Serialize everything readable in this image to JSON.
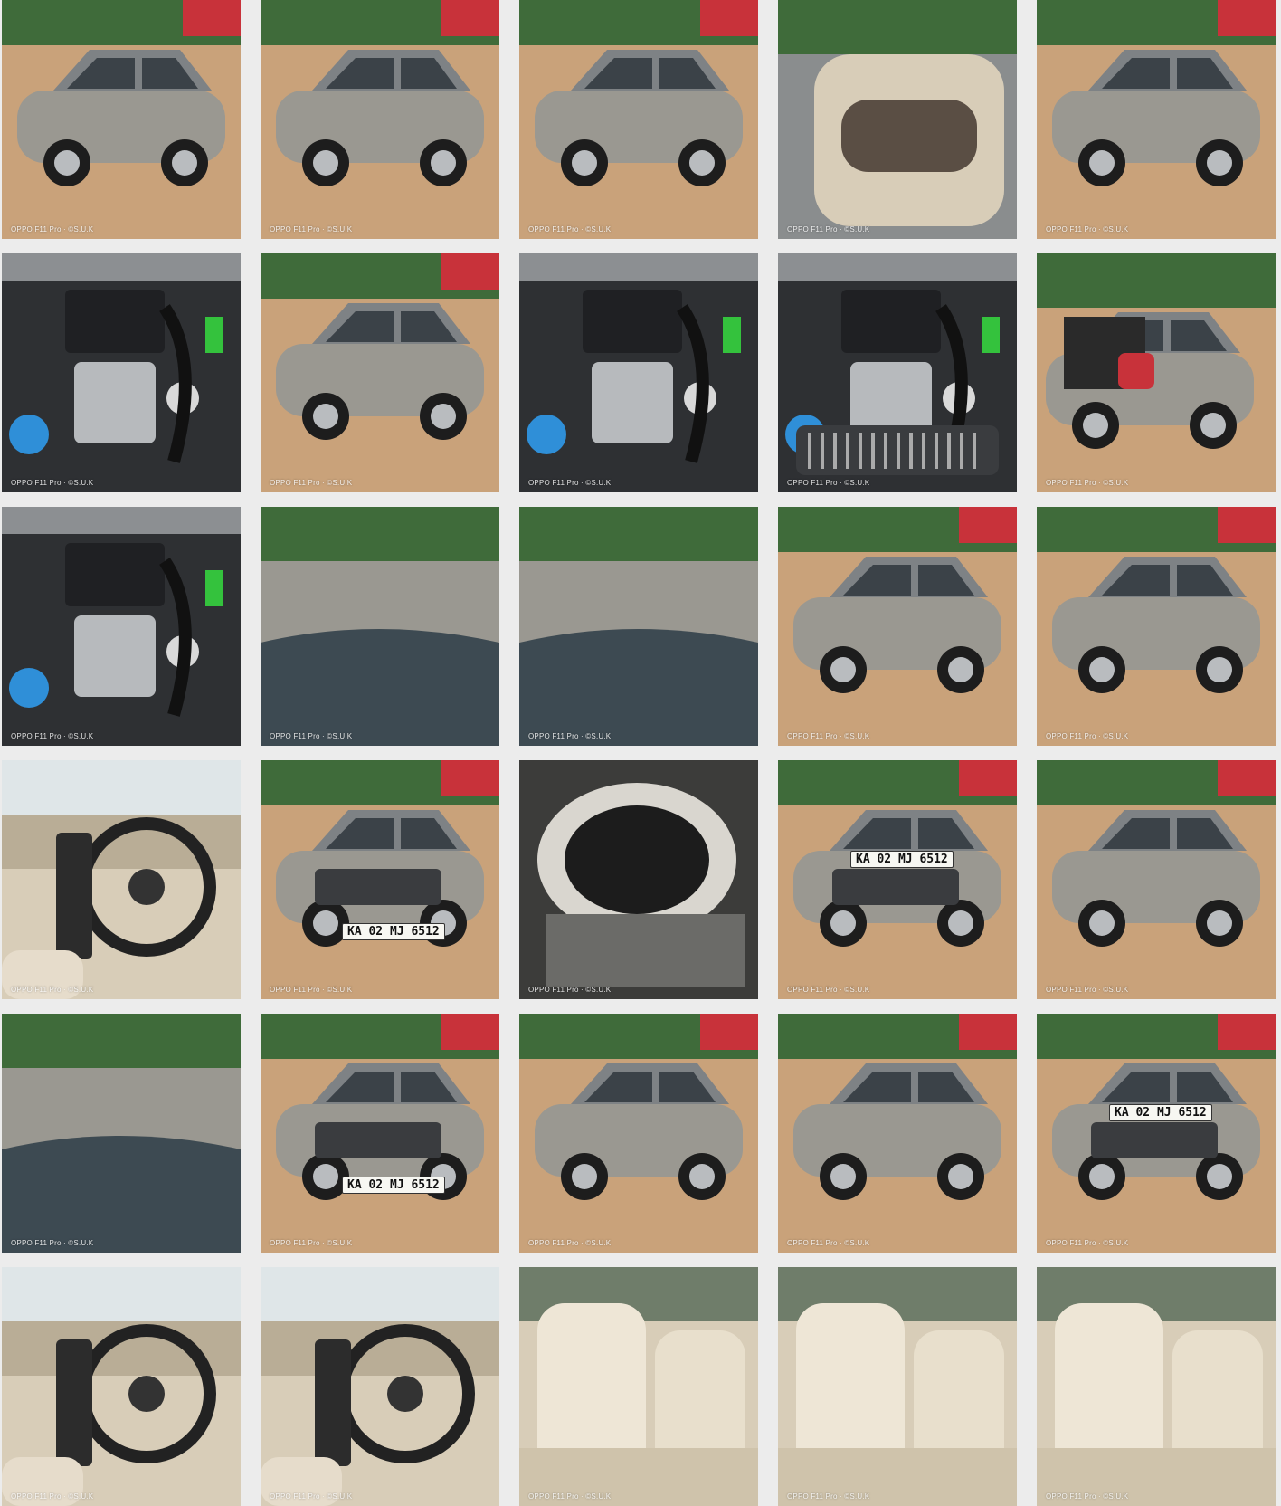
{
  "gallery": {
    "watermark": "OPPO F11 Pro · ©S.U.K",
    "plate_text": "KA 02 MJ 6512",
    "colors": {
      "car_silver": "#9a9891",
      "dirt": "#c9a27a",
      "engine_dark": "#2e3033",
      "interior_beige": "#d8cdb8",
      "sky": "#dfe6e8",
      "tree": "#3f6b3a",
      "red_car": "#c8323a",
      "coolant_blue": "#2f8fd8",
      "green_part": "#34c23d"
    },
    "photos": [
      {
        "kind": "front-wheel",
        "plate": false
      },
      {
        "kind": "side-rear",
        "plate": false
      },
      {
        "kind": "open-door-side",
        "plate": false
      },
      {
        "kind": "door-panel",
        "plate": false
      },
      {
        "kind": "open-door-front",
        "plate": false
      },
      {
        "kind": "engine",
        "plate": false
      },
      {
        "kind": "fender-mirror",
        "plate": false
      },
      {
        "kind": "engine",
        "plate": false
      },
      {
        "kind": "engine-grille",
        "plate": false
      },
      {
        "kind": "open-trunk",
        "plate": false
      },
      {
        "kind": "engine",
        "plate": false
      },
      {
        "kind": "hood",
        "plate": false
      },
      {
        "kind": "windshield",
        "plate": false
      },
      {
        "kind": "side-doors",
        "plate": false
      },
      {
        "kind": "rear-wheel",
        "plate": false
      },
      {
        "kind": "dashboard",
        "plate": false
      },
      {
        "kind": "front",
        "plate": true
      },
      {
        "kind": "spare-wheel",
        "plate": false
      },
      {
        "kind": "rear",
        "plate": true
      },
      {
        "kind": "side-open-door",
        "plate": false
      },
      {
        "kind": "roof",
        "plate": false
      },
      {
        "kind": "front",
        "plate": true
      },
      {
        "kind": "front-open-door",
        "plate": false
      },
      {
        "kind": "side-angle",
        "plate": false
      },
      {
        "kind": "rear",
        "plate": true
      },
      {
        "kind": "interior-front",
        "plate": false
      },
      {
        "kind": "interior-front",
        "plate": false
      },
      {
        "kind": "seats",
        "plate": false
      },
      {
        "kind": "rear-door-seat",
        "plate": false
      },
      {
        "kind": "rear-seats",
        "plate": false
      }
    ]
  }
}
